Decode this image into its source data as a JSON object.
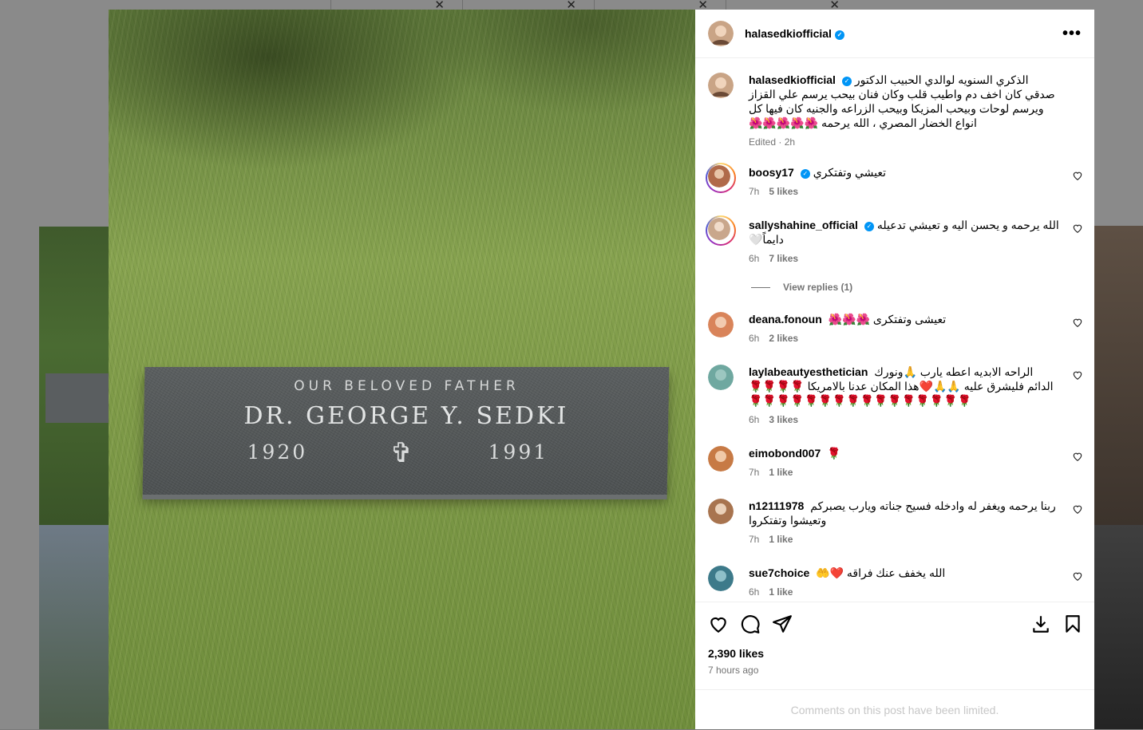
{
  "post": {
    "username": "halasedkiofficial",
    "more_icon": "more-horizontal-icon",
    "stone": {
      "line1": "OUR BELOVED FATHER",
      "line2": "DR. GEORGE Y. SEDKI",
      "year_born": "1920",
      "year_died": "1991",
      "cross": "✞"
    },
    "caption": {
      "username": "halasedkiofficial",
      "text": "الذكري السنويه لوالدي الحبيب الدكتور صدقي كان اخف دم واطيب قلب وكان فنان بيحب يرسم علي القزاز ويرسم لوحات وبيحب المزيكا وبيحب الزراعه والجنيه كان فيها كل انواع الخضار المصري ، الله يرحمه 🌺🌺🌺🌺🌺",
      "meta": "Edited · 2h"
    },
    "comments": [
      {
        "username": "boosy17",
        "verified": true,
        "text": "تعيشي وتفتكري",
        "time": "7h",
        "likes": "5 likes",
        "avatar_color": "#b06a4a"
      },
      {
        "username": "sallyshahine_official",
        "verified": true,
        "text": "الله يرحمه و يحسن اليه و تعيشي تدعيله دايماً🤍",
        "time": "6h",
        "likes": "7 likes",
        "avatar_color": "#c9a78c"
      },
      {
        "username": "deana.fonoun",
        "verified": false,
        "text": "تعيشى وتفتكرى 🌺🌺🌺",
        "time": "6h",
        "likes": "2 likes",
        "avatar_color": "#d9845a"
      },
      {
        "username": "laylabeautyesthetician",
        "verified": false,
        "text": "الراحه الابديه اعطه يارب 🙏ونورك الدائم فليشرق عليه 🙏🙏❤️هذا المكان عدنا بالامريكا 🌹🌹🌹🌹🌹🌹🌹🌹🌹🌹🌹🌹🌹🌹🌹🌹🌹🌹🌹🌹",
        "time": "6h",
        "likes": "3 likes",
        "avatar_color": "#6fa8a0"
      },
      {
        "username": "eimobond007",
        "verified": false,
        "text": "🌹",
        "time": "7h",
        "likes": "1 like",
        "avatar_color": "#c77a45"
      },
      {
        "username": "n12111978",
        "verified": false,
        "text": "ربنا يرحمه ويغفر له وادخله فسيح جناته ويارب يصبركم وتعيشوا وتفتكروا",
        "time": "7h",
        "likes": "1 like",
        "avatar_color": "#a8744f"
      },
      {
        "username": "sue7choice",
        "verified": false,
        "text": "الله يخفف عنك فراقه ❤️🤲",
        "time": "6h",
        "likes": "1 like",
        "avatar_color": "#3d7a8a"
      }
    ],
    "view_replies": "View replies (1)",
    "likes_total": "2,390 likes",
    "posted_ago": "7 hours ago",
    "limited_notice": "Comments on this post have been limited."
  }
}
